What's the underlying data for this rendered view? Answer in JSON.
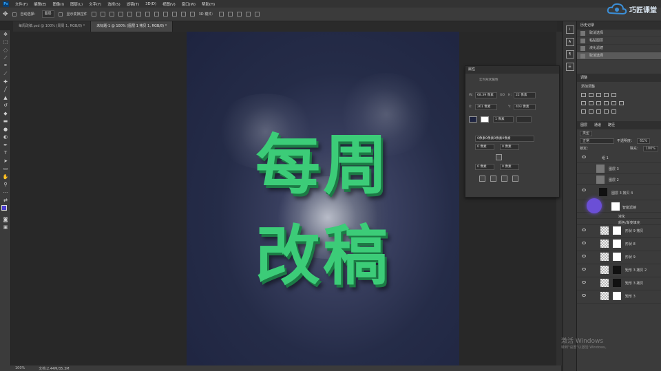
{
  "menubar": {
    "app_icon": "Ps",
    "items": [
      "文件(F)",
      "编辑(E)",
      "图像(I)",
      "图层(L)",
      "文字(Y)",
      "选择(S)",
      "滤镜(T)",
      "3D(D)",
      "视图(V)",
      "窗口(W)",
      "帮助(H)"
    ]
  },
  "options": {
    "auto_select_label": "自动选择：",
    "auto_select_value": "图层",
    "show_transform_label": "显示变换控件",
    "mode_label": "3D 模式："
  },
  "logo": {
    "text": "巧匠课堂",
    "color": "#3b8fd8",
    "icon": "cloud-logo-icon"
  },
  "tabs": [
    {
      "label": "每周改稿.psd @ 100% (周周 1, RGB/8) *",
      "active": false
    },
    {
      "label": "未标题-1 @ 100% (图层 1 拷贝 1, RGB/8) *",
      "active": true
    }
  ],
  "canvas": {
    "line1": "每周",
    "line2": "改稿",
    "text_color": "#3ccc78",
    "bg_color": "#252c48"
  },
  "statusbar": {
    "zoom": "100%",
    "doc": "文档:2.44M/35.3M"
  },
  "history": {
    "tabs": [
      "历史记录"
    ],
    "items": [
      {
        "label": "取消选择",
        "selected": false
      },
      {
        "label": "粘贴图层",
        "selected": false
      },
      {
        "label": "液化滤镜",
        "selected": false
      },
      {
        "label": "取消选择",
        "selected": true
      }
    ]
  },
  "adjustments": {
    "title": "调整",
    "subtitle": "添加调整"
  },
  "layers": {
    "tabs": [
      "图层",
      "通道",
      "路径"
    ],
    "kind": "类型",
    "blend": "正常",
    "opacity_label": "不透明度：",
    "opacity": "61%",
    "lock_label": "锁定：",
    "fill_label": "填充：",
    "fill": "100%",
    "items": [
      {
        "name": "组 1"
      },
      {
        "name": "图层 3"
      },
      {
        "name": "图层 2"
      },
      {
        "name": "图层 3 拷贝 4"
      },
      {
        "name": "智能滤镜"
      },
      {
        "name": "液化"
      },
      {
        "name": "颜色/渐变填充"
      },
      {
        "name": "形状 9 拷贝"
      },
      {
        "name": "形状 8"
      },
      {
        "name": "形状 9"
      },
      {
        "name": "矩形 3 拷贝 2"
      },
      {
        "name": "矩形 3 拷贝"
      },
      {
        "name": "矩形 3"
      }
    ]
  },
  "properties": {
    "title": "属性",
    "subtitle": "实时形状属性",
    "w_label": "W:",
    "w": "68.39 像素",
    "go_label": "GO",
    "h_label": "H:",
    "h": "22 像素",
    "x_label": "X:",
    "x": "261 像素",
    "y_label": "Y:",
    "y": "403 像素",
    "stroke": "1 像素",
    "corner_label": "0像素0像素0像素0像素",
    "c1": "0 像素",
    "c2": "0 像素",
    "c3": "0 像素",
    "c4": "0 像素"
  },
  "watermark": {
    "line1": "激活 Windows",
    "line2": "转到\"设置\"以激活 Windows。"
  }
}
